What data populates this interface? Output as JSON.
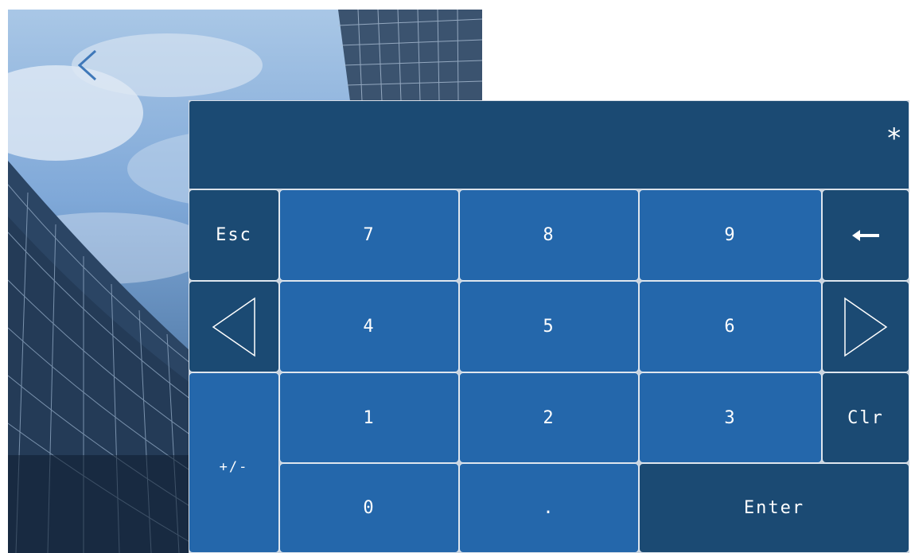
{
  "background": {
    "description_icon": "building-photo"
  },
  "nav": {
    "back_icon": "chevron-left-icon"
  },
  "display": {
    "value": "*"
  },
  "keys": {
    "esc": "Esc",
    "seven": "7",
    "eight": "8",
    "nine": "9",
    "backspace_icon": "arrow-left-icon",
    "left_icon": "triangle-left-icon",
    "four": "4",
    "five": "5",
    "six": "6",
    "right_icon": "triangle-right-icon",
    "plus_minus": "+/-",
    "one": "1",
    "two": "2",
    "three": "3",
    "clear": "Clr",
    "zero": "0",
    "dot": ".",
    "enter": "Enter"
  },
  "colors": {
    "key_blue": "#2467ab",
    "key_dark": "#1b4a73",
    "text": "#ffffff"
  }
}
